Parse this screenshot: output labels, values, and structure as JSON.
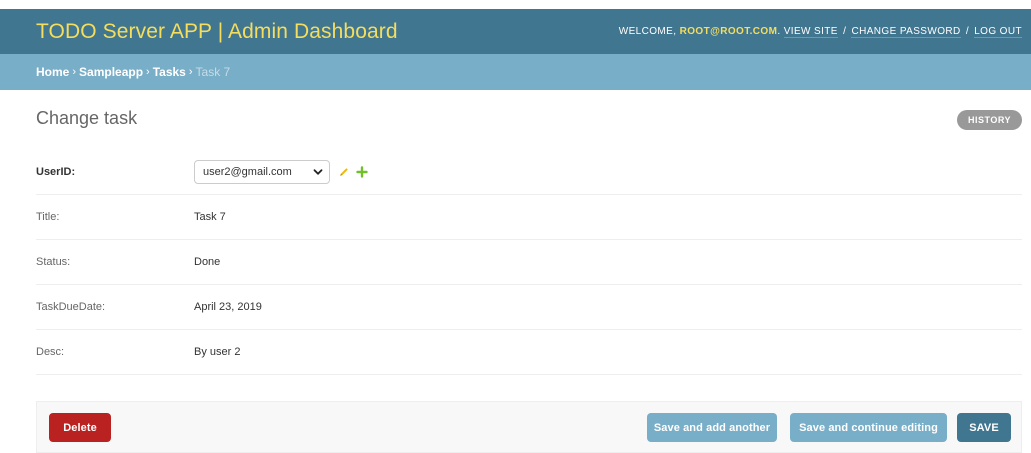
{
  "header": {
    "brand": "TODO Server APP | Admin Dashboard",
    "welcome_prefix": "WELCOME,",
    "username": "ROOT@ROOT.COM",
    "welcome_suffix": ".",
    "view_site": "VIEW SITE",
    "change_password": "CHANGE PASSWORD",
    "log_out": "LOG OUT",
    "separator": "/"
  },
  "breadcrumbs": {
    "items": [
      "Home",
      "Sampleapp",
      "Tasks"
    ],
    "current": "Task 7",
    "separator": "›"
  },
  "page": {
    "title": "Change task",
    "history_label": "HISTORY"
  },
  "form": {
    "fields": [
      {
        "label": "UserID:",
        "value": "user2@gmail.com",
        "type": "select"
      },
      {
        "label": "Title:",
        "value": "Task 7"
      },
      {
        "label": "Status:",
        "value": "Done"
      },
      {
        "label": "TaskDueDate:",
        "value": "April 23, 2019"
      },
      {
        "label": "Desc:",
        "value": "By user 2"
      }
    ],
    "related_icons": [
      "pencil-icon",
      "plus-icon"
    ]
  },
  "submit": {
    "delete_label": "Delete",
    "save_add_another_label": "Save and add another",
    "save_continue_label": "Save and continue editing",
    "save_label": "SAVE"
  },
  "colors": {
    "header_bg": "#417690",
    "brand_text": "#f5dd5d",
    "breadcrumbs_bg": "#79aec8",
    "delete_bg": "#ba2121",
    "secondary_button_bg": "#79aec8",
    "primary_button_bg": "#417690"
  }
}
